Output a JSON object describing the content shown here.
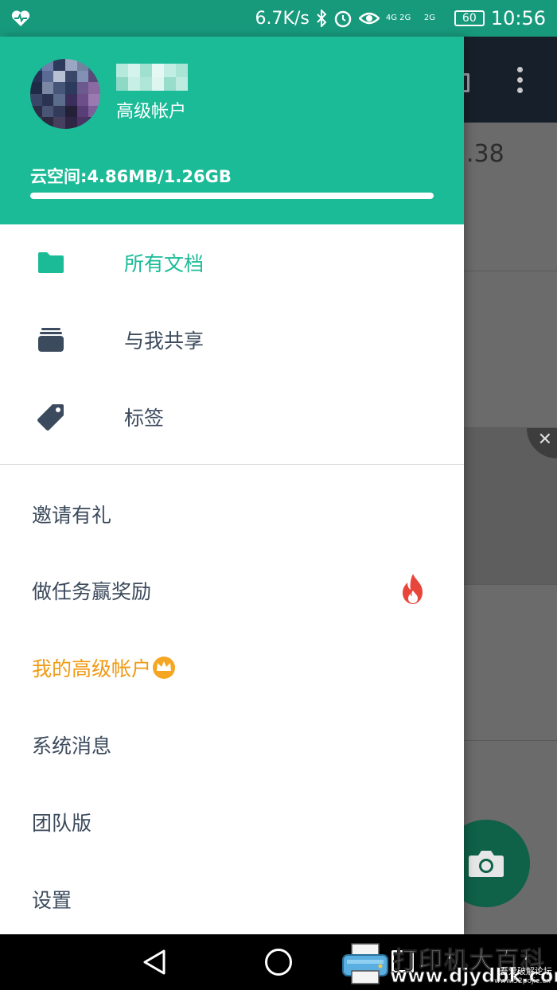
{
  "status_bar": {
    "net_speed": "6.7K/s",
    "signal_1": "4G 2G",
    "signal_2": "2G",
    "battery": "60",
    "time": "10:56"
  },
  "background": {
    "card_fragment": ".38"
  },
  "drawer": {
    "account_type": "高级帐户",
    "storage_label": "云空间:4.86MB/1.26GB",
    "storage_used_fraction": 0.004,
    "nav": [
      {
        "label": "所有文档",
        "icon": "folder-icon",
        "active": true
      },
      {
        "label": "与我共享",
        "icon": "shared-stack-icon",
        "active": false
      },
      {
        "label": "标签",
        "icon": "tag-icon",
        "active": false
      }
    ],
    "menu": [
      {
        "label": "邀请有礼"
      },
      {
        "label": "做任务赢奖励"
      },
      {
        "label": "我的高级帐户"
      },
      {
        "label": "系统消息"
      },
      {
        "label": "团队版"
      },
      {
        "label": "设置"
      }
    ]
  },
  "colors": {
    "accent": "#1bbb98",
    "premium": "#f09a13",
    "fire": "#e8463a"
  },
  "watermark": {
    "title": "打印机大百科",
    "url": "www.djydbk.com",
    "sub": "吾爱破解论坛",
    "sub2": "www.52pojie.cn"
  }
}
